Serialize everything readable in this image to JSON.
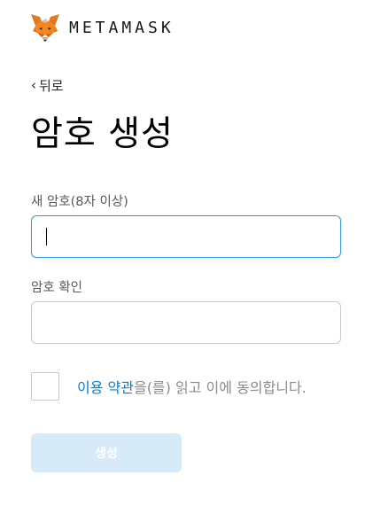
{
  "header": {
    "logo_icon": "metamask-fox-icon",
    "wordmark": "METAMASK"
  },
  "nav": {
    "back_chevron": "‹",
    "back_label": "뒤로"
  },
  "page": {
    "title": "암호 생성"
  },
  "form": {
    "new_password_label": "새 암호(8자 이상)",
    "new_password_value": "",
    "confirm_password_label": "암호 확인",
    "confirm_password_value": "",
    "terms_checked": false,
    "terms_link": "이용 약관",
    "terms_rest": "을(를) 읽고 이에 동의합니다.",
    "create_button": "생성"
  },
  "colors": {
    "accent": "#037dd6",
    "focus_border": "#2f9ae0",
    "disabled_button": "#d6eaf8"
  }
}
